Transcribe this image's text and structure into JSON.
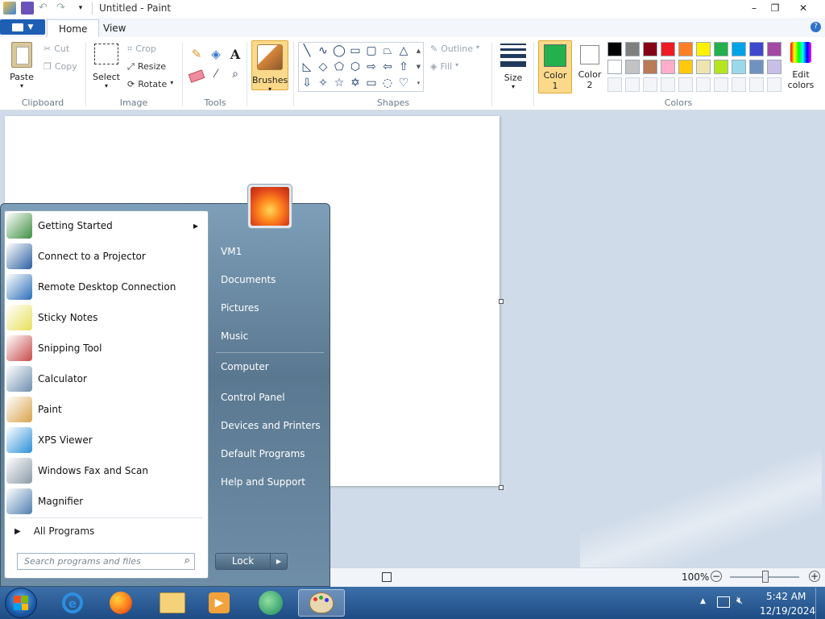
{
  "window": {
    "title": "Untitled - Paint"
  },
  "ribbon": {
    "tabs": [
      "Home",
      "View"
    ],
    "clipboard": {
      "paste": "Paste",
      "cut": "Cut",
      "copy": "Copy",
      "group": "Clipboard"
    },
    "image": {
      "select": "Select",
      "crop": "Crop",
      "resize": "Resize",
      "rotate": "Rotate",
      "group": "Image"
    },
    "tools": {
      "group": "Tools"
    },
    "brushes": {
      "label": "Brushes"
    },
    "shapes": {
      "outline": "Outline",
      "fill": "Fill",
      "group": "Shapes"
    },
    "size": {
      "label": "Size"
    },
    "color1": {
      "label": "Color",
      "num": "1",
      "value": "#22b14c"
    },
    "color2": {
      "label": "Color",
      "num": "2",
      "value": "#ffffff"
    },
    "colors": {
      "group": "Colors",
      "edit": "Edit",
      "edit2": "colors",
      "palette_row1": [
        "#000000",
        "#7f7f7f",
        "#880015",
        "#ed1c24",
        "#ff7f27",
        "#fff200",
        "#22b14c",
        "#00a2e8",
        "#3f48cc",
        "#a349a4"
      ],
      "palette_row2": [
        "#ffffff",
        "#c3c3c3",
        "#b97a57",
        "#ffaec9",
        "#ffc90e",
        "#efe4b0",
        "#b5e61d",
        "#99d9ea",
        "#7092be",
        "#c8bfe7"
      ]
    }
  },
  "statusbar": {
    "zoom": "100%"
  },
  "startmenu": {
    "programs": [
      {
        "label": "Getting Started",
        "icon": "getting-started-icon",
        "color": "#3e8e41"
      },
      {
        "label": "Connect to a Projector",
        "icon": "projector-icon",
        "color": "#2b5fa0"
      },
      {
        "label": "Remote Desktop Connection",
        "icon": "remote-desktop-icon",
        "color": "#2a6fb8"
      },
      {
        "label": "Sticky Notes",
        "icon": "sticky-notes-icon",
        "color": "#e8e05a"
      },
      {
        "label": "Snipping Tool",
        "icon": "snipping-tool-icon",
        "color": "#c74a4a"
      },
      {
        "label": "Calculator",
        "icon": "calculator-icon",
        "color": "#6f8fae"
      },
      {
        "label": "Paint",
        "icon": "paint-icon",
        "color": "#d9a24a"
      },
      {
        "label": "XPS Viewer",
        "icon": "xps-viewer-icon",
        "color": "#2a8fd8"
      },
      {
        "label": "Windows Fax and Scan",
        "icon": "fax-scan-icon",
        "color": "#8a9aa8"
      },
      {
        "label": "Magnifier",
        "icon": "magnifier-icon",
        "color": "#4f7fb0"
      }
    ],
    "all_programs": "All Programs",
    "search_placeholder": "Search programs and files",
    "right_links": [
      "VM1",
      "Documents",
      "Pictures",
      "Music",
      "Computer",
      "Control Panel",
      "Devices and Printers",
      "Default Programs",
      "Help and Support"
    ],
    "lock": "Lock"
  },
  "taskbar": {
    "time": "5:42 AM",
    "date": "12/19/2024"
  }
}
